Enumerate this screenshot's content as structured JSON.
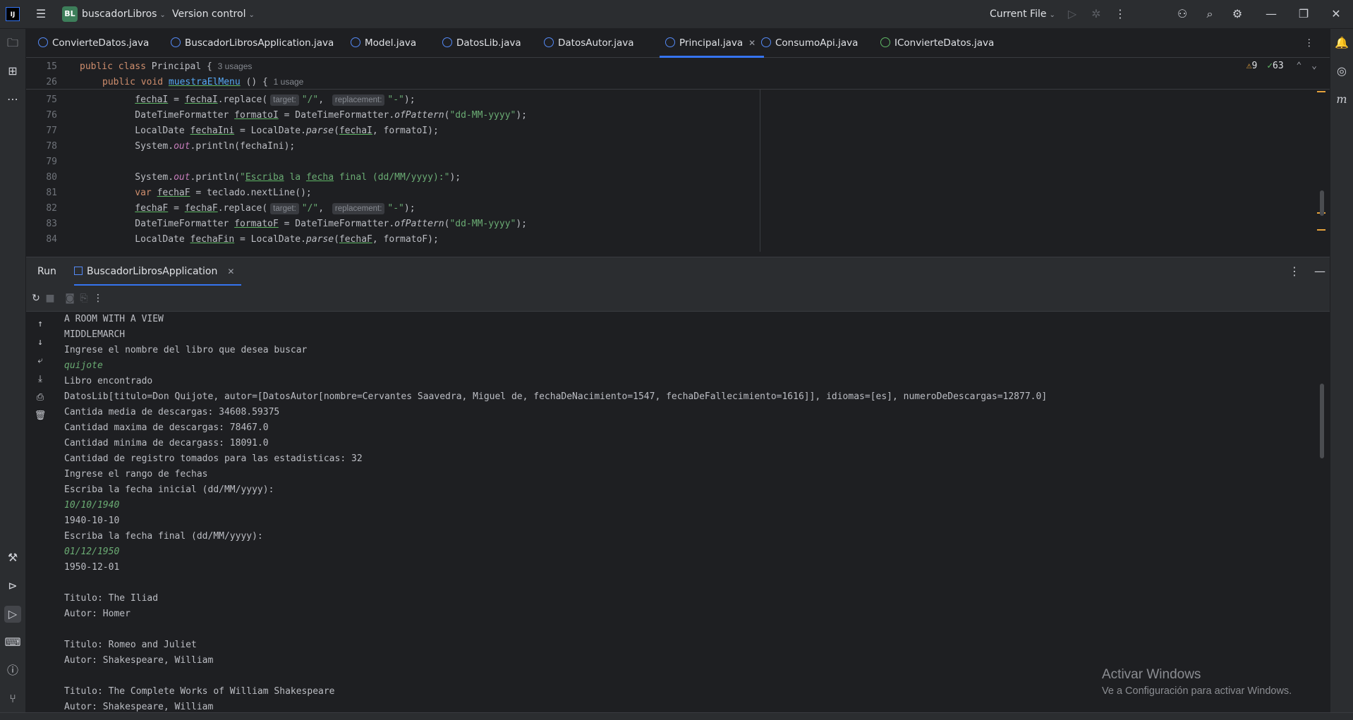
{
  "titlebar": {
    "project_badge": "BL",
    "project_name": "buscadorLibros",
    "vcs": "Version control",
    "run_config": "Current File"
  },
  "tabs": [
    {
      "label": "ConvierteDatos.java"
    },
    {
      "label": "BuscadorLibrosApplication.java"
    },
    {
      "label": "Model.java"
    },
    {
      "label": "DatosLib.java"
    },
    {
      "label": "DatosAutor.java"
    },
    {
      "label": "Principal.java",
      "active": true
    },
    {
      "label": "ConsumoApi.java"
    },
    {
      "label": "IConvierteDatos.java"
    }
  ],
  "sticky": {
    "l1_num": "15",
    "l1_kw": "public class",
    "l1_name": "Principal {",
    "l1_hint": "3 usages",
    "l2_num": "26",
    "l2_kw": "public void",
    "l2_name": "muestraElMenu",
    "l2_rest": " () {",
    "l2_hint": "1 usage"
  },
  "inspections": {
    "warnings": "9",
    "ok": "63"
  },
  "code": {
    "n75": "75",
    "n76": "76",
    "n77": "77",
    "n78": "78",
    "n79": "79",
    "n80": "80",
    "n81": "81",
    "n82": "82",
    "n83": "83",
    "n84": "84",
    "target_hint": "target:",
    "replacement_hint": "replacement:"
  },
  "run": {
    "title": "Run",
    "tab": "BuscadorLibrosApplication"
  },
  "console": [
    {
      "text": "A ROOM WITH A VIEW",
      "input": false
    },
    {
      "text": "MIDDLEMARCH",
      "input": false
    },
    {
      "text": "Ingrese el nombre del libro que desea buscar",
      "input": false
    },
    {
      "text": "quijote",
      "input": true
    },
    {
      "text": "Libro encontrado",
      "input": false
    },
    {
      "text": "DatosLib[titulo=Don Quijote, autor=[DatosAutor[nombre=Cervantes Saavedra, Miguel de, fechaDeNacimiento=1547, fechaDeFallecimiento=1616]], idiomas=[es], numeroDeDescargas=12877.0]",
      "input": false
    },
    {
      "text": "Cantida media de descargas: 34608.59375",
      "input": false
    },
    {
      "text": "Cantidad maxima de descargas: 78467.0",
      "input": false
    },
    {
      "text": "Cantidad minima de decargass: 18091.0",
      "input": false
    },
    {
      "text": "Cantidad de registro tomados para las estadisticas: 32",
      "input": false
    },
    {
      "text": "Ingrese el rango de fechas",
      "input": false
    },
    {
      "text": "Escriba la fecha inicial (dd/MM/yyyy):",
      "input": false
    },
    {
      "text": "10/10/1940",
      "input": true
    },
    {
      "text": "1940-10-10",
      "input": false
    },
    {
      "text": "Escriba la fecha final (dd/MM/yyyy):",
      "input": false
    },
    {
      "text": "01/12/1950",
      "input": true
    },
    {
      "text": "1950-12-01",
      "input": false
    },
    {
      "text": "",
      "input": false
    },
    {
      "text": "Titulo: The Iliad",
      "input": false
    },
    {
      "text": "Autor: Homer",
      "input": false
    },
    {
      "text": "",
      "input": false
    },
    {
      "text": "Titulo: Romeo and Juliet",
      "input": false
    },
    {
      "text": "Autor: Shakespeare, William",
      "input": false
    },
    {
      "text": "",
      "input": false
    },
    {
      "text": "Titulo: The Complete Works of William Shakespeare",
      "input": false
    },
    {
      "text": "Autor: Shakespeare, William",
      "input": false
    }
  ],
  "watermark": {
    "line1": "Activar Windows",
    "line2": "Ve a Configuración para activar Windows."
  },
  "colors": {
    "background": "#1e1f22",
    "panel": "#2b2d30",
    "accent": "#3574f0",
    "string": "#6aab73",
    "keyword": "#cf8e6d",
    "function": "#56a8f5",
    "static_field": "#c77dbb"
  }
}
